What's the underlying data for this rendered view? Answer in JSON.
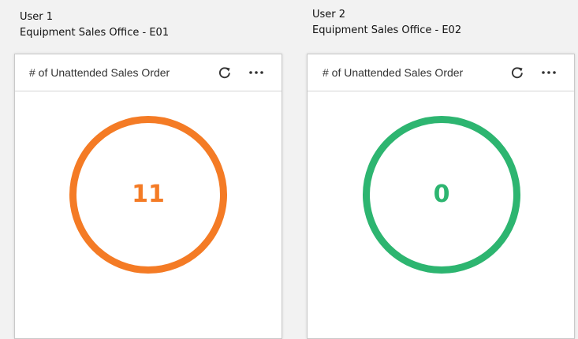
{
  "users": [
    {
      "user_label": "User 1",
      "office_label": "Equipment Sales Office  - E01",
      "card": {
        "title": "# of Unattended Sales Order",
        "value": "11",
        "status_color": "#f47b25",
        "refresh_icon": "refresh-icon",
        "more_icon": "more-horizontal-icon"
      }
    },
    {
      "user_label": "User 2",
      "office_label": "Equipment Sales Office  - E02",
      "card": {
        "title": "# of Unattended Sales Order",
        "value": "0",
        "status_color": "#2db570",
        "refresh_icon": "refresh-icon",
        "more_icon": "more-horizontal-icon"
      }
    }
  ]
}
